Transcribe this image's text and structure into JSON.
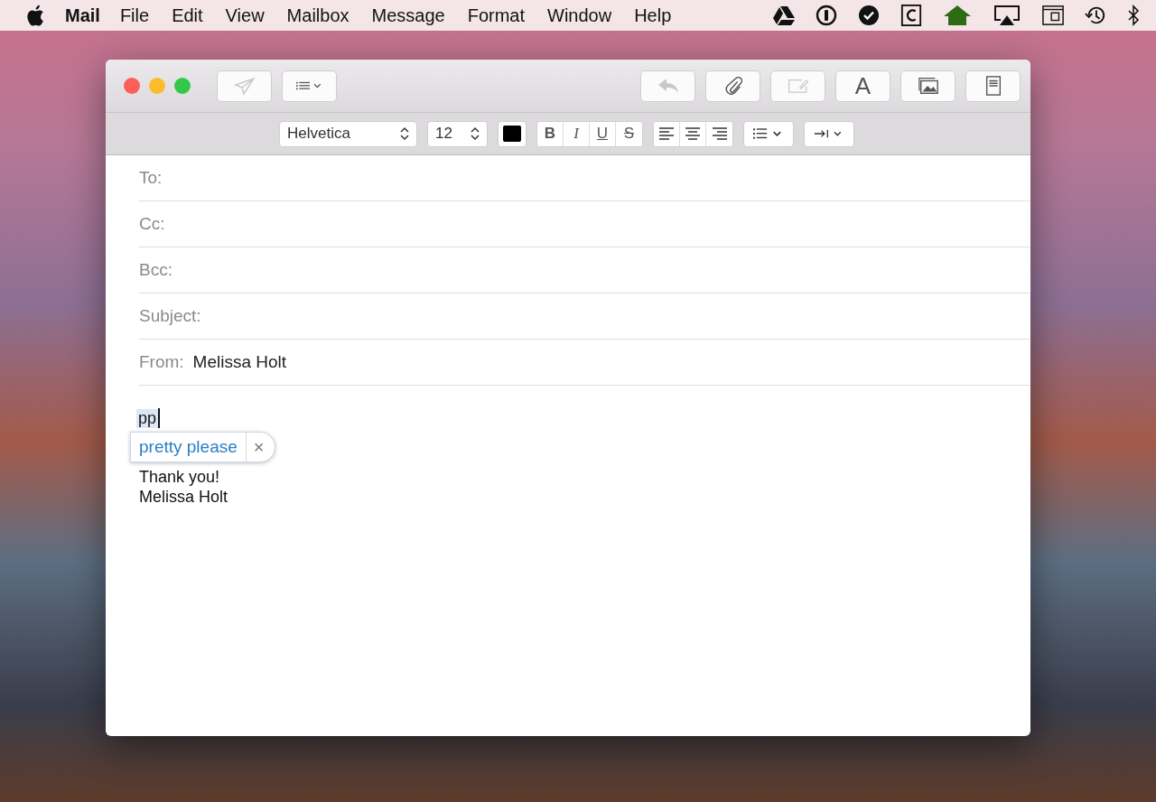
{
  "menubar": {
    "app": "Mail",
    "menus": [
      "File",
      "Edit",
      "View",
      "Mailbox",
      "Message",
      "Format",
      "Window",
      "Help"
    ],
    "status_icons": [
      {
        "kind": "drive"
      },
      {
        "kind": "info"
      },
      {
        "kind": "check"
      },
      {
        "kind": "c"
      },
      {
        "kind": "house"
      },
      {
        "kind": "airplay"
      },
      {
        "kind": "command"
      },
      {
        "kind": "clock"
      },
      {
        "kind": "bluetooth"
      }
    ]
  },
  "toolbar": {
    "left": [
      {
        "kind": "send",
        "disabled": true
      },
      {
        "kind": "list",
        "disabled": false
      }
    ],
    "right": [
      {
        "kind": "reply",
        "disabled": true
      },
      {
        "kind": "attach",
        "disabled": false
      },
      {
        "kind": "markup",
        "disabled": true
      },
      {
        "kind": "font",
        "label": "A",
        "disabled": false
      },
      {
        "kind": "photo",
        "disabled": false
      },
      {
        "kind": "stationery",
        "disabled": false
      }
    ]
  },
  "format_bar": {
    "font": "Helvetica",
    "size": "12",
    "styles": [
      {
        "kind": "bold",
        "label": "B"
      },
      {
        "kind": "italic",
        "label": "I"
      },
      {
        "kind": "underline",
        "label": "U"
      },
      {
        "kind": "strike",
        "label": "S"
      }
    ]
  },
  "header_fields": [
    {
      "label": "To:"
    },
    {
      "label": "Cc:"
    },
    {
      "label": "Bcc:"
    },
    {
      "label": "Subject:"
    },
    {
      "label": "From:",
      "value": "Melissa Holt"
    }
  ],
  "body": {
    "typed": "pp",
    "suggestion": "pretty please",
    "dismiss": "×",
    "lines": [
      "Thank you!",
      "Melissa Holt"
    ]
  }
}
